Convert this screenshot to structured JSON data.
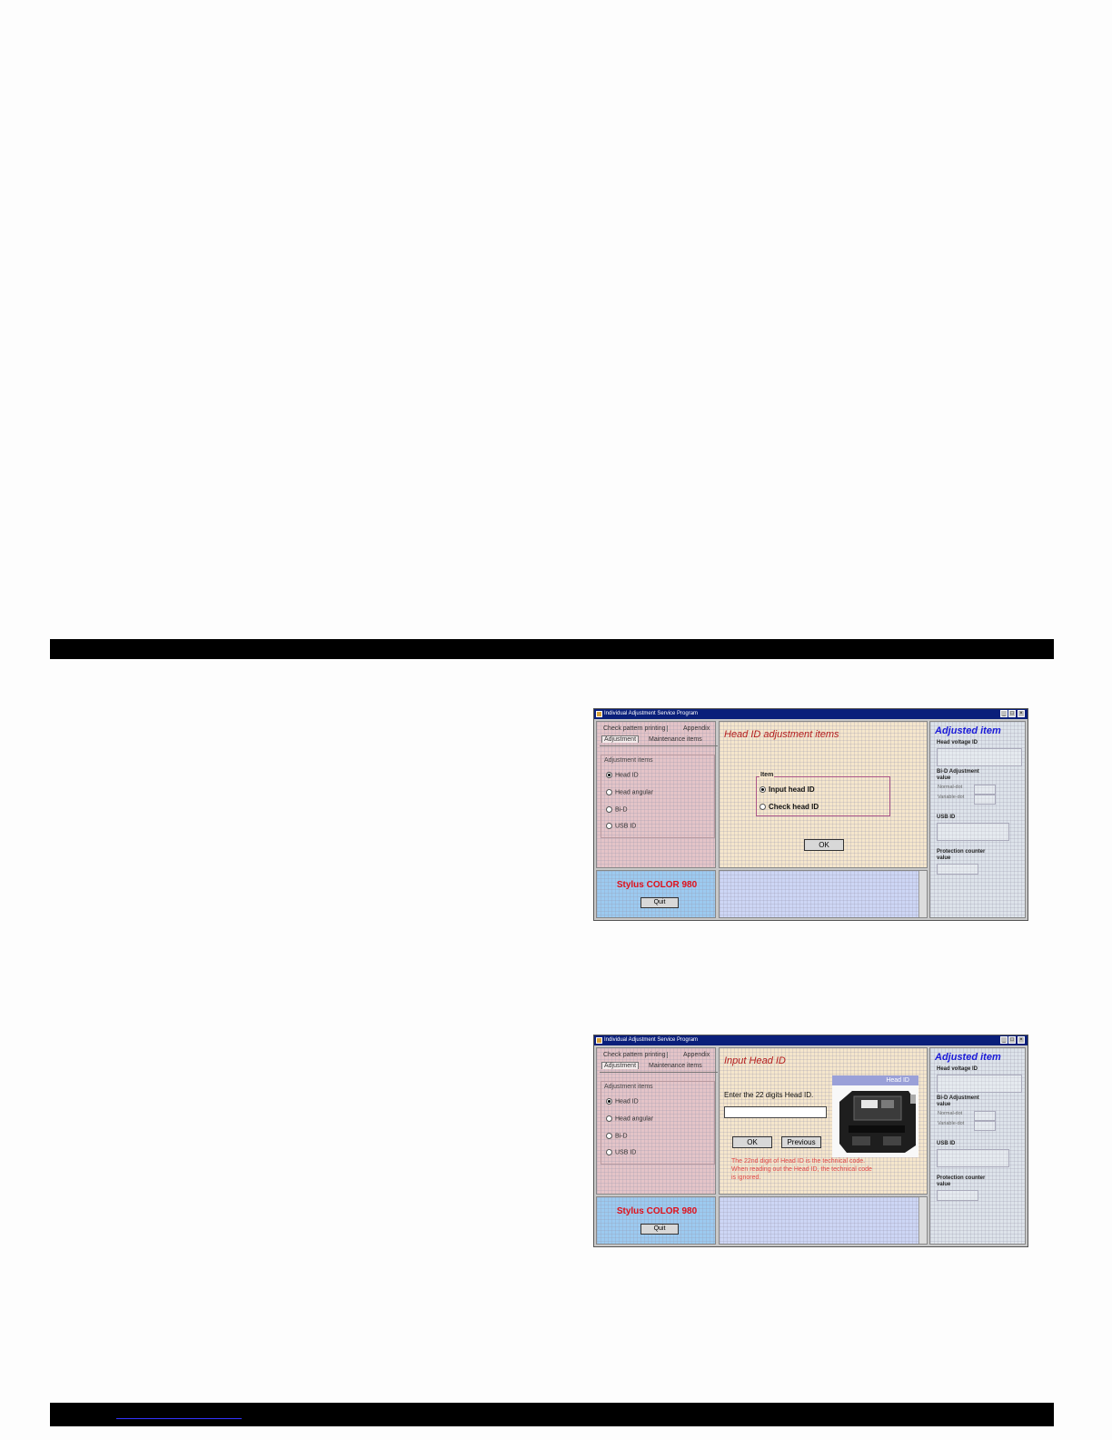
{
  "window": {
    "title": "Individual Adjustment Service Program",
    "min": "_",
    "max": "□",
    "close": "×"
  },
  "tabs": {
    "check_pattern": "Check pattern printing",
    "appendix": "Appendix",
    "adjustment": "Adjustment",
    "maintenance": "Maintenance items"
  },
  "adjustment_items": {
    "title": "Adjustment items",
    "options": [
      "Head ID",
      "Head angular",
      "Bi-D",
      "USB ID"
    ],
    "selected": "Head ID"
  },
  "model": {
    "name": "Stylus COLOR 980",
    "quit_label": "Quit"
  },
  "screen1": {
    "center_title": "Head ID adjustment items",
    "item_group_title": "Item",
    "options": [
      "Input head ID",
      "Check head ID"
    ],
    "selected": "Input head ID",
    "ok_label": "OK"
  },
  "screen2": {
    "center_title": "Input Head ID",
    "entry_label": "Enter the 22 digits Head ID.",
    "entry_value": "",
    "ok_label": "OK",
    "previous_label": "Previous",
    "image_caption": "Head ID",
    "note_lines": [
      "The 22nd digit of Head ID is the technical code.",
      "When reading out the Head ID, the technical code",
      "is ignored."
    ]
  },
  "adjusted_item": {
    "title": "Adjusted item",
    "head_voltage_label": "Head voltage ID",
    "bid_label_1": "Bi-D Adjustment",
    "bid_label_2": "value",
    "normal_dot": "Normal-dot",
    "variable_dot": "Variable-dot",
    "usb_label": "USB ID",
    "protection_label_1": "Protection counter",
    "protection_label_2": "value"
  },
  "colors": {
    "title_bar": "#0a1f7a",
    "left_panel": "#e4c4c8",
    "center_panel": "#f5e6cc",
    "model_panel": "#9ccaf0",
    "right_panel": "#dde3ea",
    "accent_red": "#e0101a",
    "accent_blue": "#1a1ad8"
  },
  "icons": [
    "app-icon",
    "minimize-icon",
    "maximize-icon",
    "close-icon",
    "radio-icon",
    "printhead-photo"
  ]
}
